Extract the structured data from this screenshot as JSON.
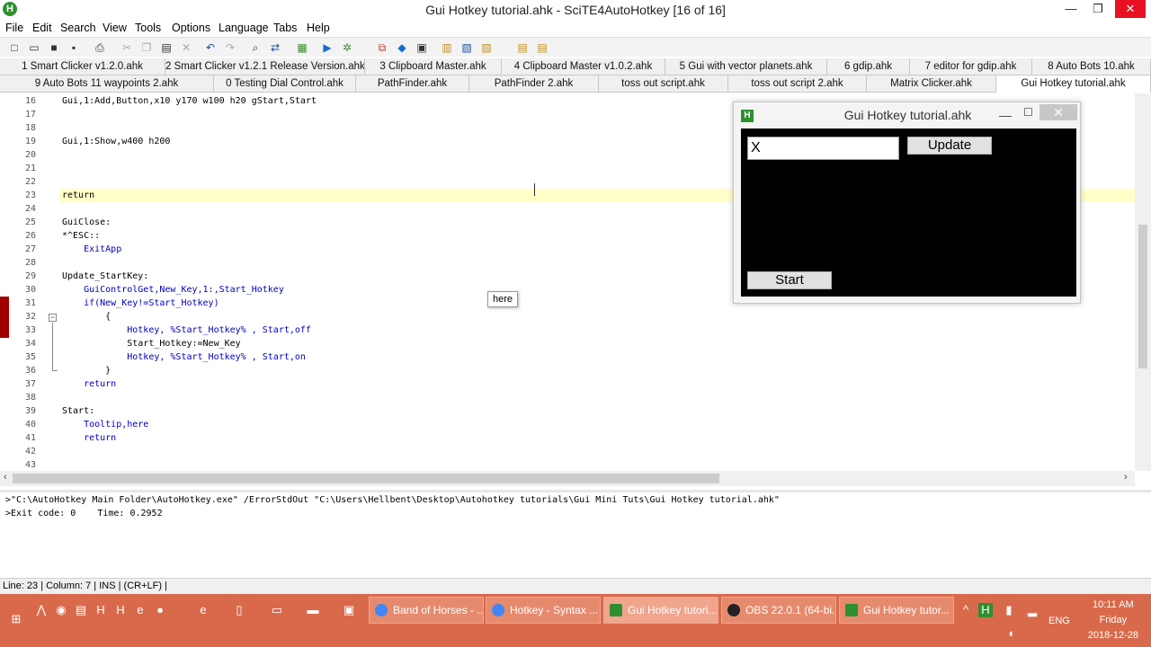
{
  "window": {
    "title": "Gui Hotkey tutorial.ahk - SciTE4AutoHotkey [16 of 16]",
    "app_icon": "H",
    "minimize_glyph": "—",
    "maximize_glyph": "❐",
    "close_glyph": "✕"
  },
  "menu": [
    "File",
    "Edit",
    "Search",
    "View",
    "Tools",
    "Options",
    "Language",
    "Tabs",
    "Help"
  ],
  "toolbar_icons": [
    "new-file-icon",
    "open-folder-icon",
    "save-icon",
    "save-as-icon",
    "print-icon",
    "cut-icon",
    "copy-icon",
    "paste-icon",
    "delete-icon",
    "undo-icon",
    "redo-icon",
    "find-icon",
    "replace-icon",
    "compile-icon",
    "run-icon",
    "debug-icon",
    "window-spy-icon",
    "settings-icon",
    "smartgui-icon",
    "help-icon",
    "folder-icon",
    "comment-icon",
    "bookmark-icon",
    "extra-icon"
  ],
  "tabs_row1": [
    "1 Smart Clicker v1.2.0.ahk",
    "2 Smart Clicker v1.2.1 Release Version.ahk",
    "3 Clipboard Master.ahk",
    "4 Clipboard Master v1.0.2.ahk",
    "5 Gui with vector planets.ahk",
    "6 gdip.ahk",
    "7 editor for gdip.ahk",
    "8 Auto Bots 10.ahk"
  ],
  "tabs_row2": [
    "9 Auto Bots 11 waypoints 2.ahk",
    "0 Testing Dial Control.ahk",
    "PathFinder.ahk",
    "PathFinder 2.ahk",
    "toss out script.ahk",
    "toss out script 2.ahk",
    "Matrix Clicker.ahk",
    "Gui Hotkey tutorial.ahk"
  ],
  "editor": {
    "lines": [
      {
        "n": "16",
        "text": "Gui,1:Add,Button,x10 y170 w100 h20 gStart,Start",
        "kw": false
      },
      {
        "n": "17",
        "text": "",
        "kw": false
      },
      {
        "n": "18",
        "text": "",
        "kw": false
      },
      {
        "n": "19",
        "text": "Gui,1:Show,w400 h200",
        "kw": false
      },
      {
        "n": "20",
        "text": "",
        "kw": false
      },
      {
        "n": "21",
        "text": "",
        "kw": false
      },
      {
        "n": "22",
        "text": "",
        "kw": false
      },
      {
        "n": "23",
        "text": "return",
        "kw": false
      },
      {
        "n": "24",
        "text": "",
        "kw": false
      },
      {
        "n": "25",
        "text": "GuiClose:",
        "kw": false
      },
      {
        "n": "26",
        "text": "*^ESC::",
        "kw": false
      },
      {
        "n": "27",
        "text": "    ExitApp",
        "kw": true
      },
      {
        "n": "28",
        "text": "",
        "kw": false
      },
      {
        "n": "29",
        "text": "Update_StartKey:",
        "kw": false
      },
      {
        "n": "30",
        "text": "    GuiControlGet,New_Key,1:,Start_Hotkey",
        "kw": true
      },
      {
        "n": "31",
        "text": "    if(New_Key!=Start_Hotkey)",
        "kw": true
      },
      {
        "n": "32",
        "text": "        {",
        "kw": false
      },
      {
        "n": "33",
        "text": "            Hotkey, %Start_Hotkey% , Start,off",
        "kw": true
      },
      {
        "n": "34",
        "text": "            Start_Hotkey:=New_Key",
        "kw": false
      },
      {
        "n": "35",
        "text": "            Hotkey, %Start_Hotkey% , Start,on",
        "kw": true
      },
      {
        "n": "36",
        "text": "        }",
        "kw": false
      },
      {
        "n": "37",
        "text": "    return",
        "kw": true
      },
      {
        "n": "38",
        "text": "",
        "kw": false
      },
      {
        "n": "39",
        "text": "Start:",
        "kw": false
      },
      {
        "n": "40",
        "text": "    Tooltip,here",
        "kw": true
      },
      {
        "n": "41",
        "text": "    return",
        "kw": true
      },
      {
        "n": "42",
        "text": "",
        "kw": false
      },
      {
        "n": "43",
        "text": "",
        "kw": false
      }
    ],
    "current_line": "23"
  },
  "tooltip": "here",
  "output": {
    "line1": ">\"C:\\AutoHotkey Main Folder\\AutoHotkey.exe\" /ErrorStdOut \"C:\\Users\\Hellbent\\Desktop\\Autohotkey tutorials\\Gui Mini Tuts\\Gui Hotkey tutorial.ahk\"",
    "line2": ">Exit code: 0    Time: 0.2952"
  },
  "status_bar": "Line: 23 | Column: 7 | INS | (CR+LF) |",
  "gui_window": {
    "title": "Gui Hotkey tutorial.ahk",
    "icon": "H",
    "minimize_glyph": "—",
    "maximize_glyph": "☐",
    "close_glyph": "✕",
    "edit_value": "X",
    "update_button": "Update",
    "start_button": "Start"
  },
  "taskbar": {
    "tasks": [
      {
        "label": "Band of Horses - ...",
        "icon_color": "#4285f4"
      },
      {
        "label": "Hotkey - Syntax ...",
        "icon_color": "#4285f4"
      },
      {
        "label": "Gui Hotkey tutori...",
        "icon_color": "#2f8f2f"
      },
      {
        "label": "OBS 22.0.1 (64-bi...",
        "icon_color": "#222222"
      },
      {
        "label": "Gui Hotkey tutor...",
        "icon_color": "#2f8f2f"
      }
    ],
    "language": "ENG",
    "time": "10:11 AM",
    "day": "Friday",
    "date": "2018-12-28"
  },
  "colors": {
    "current_line_highlight": "#ffffc8",
    "keyword": "#0000c0",
    "taskbar": "#d86a4b",
    "close_button": "#e81123"
  }
}
